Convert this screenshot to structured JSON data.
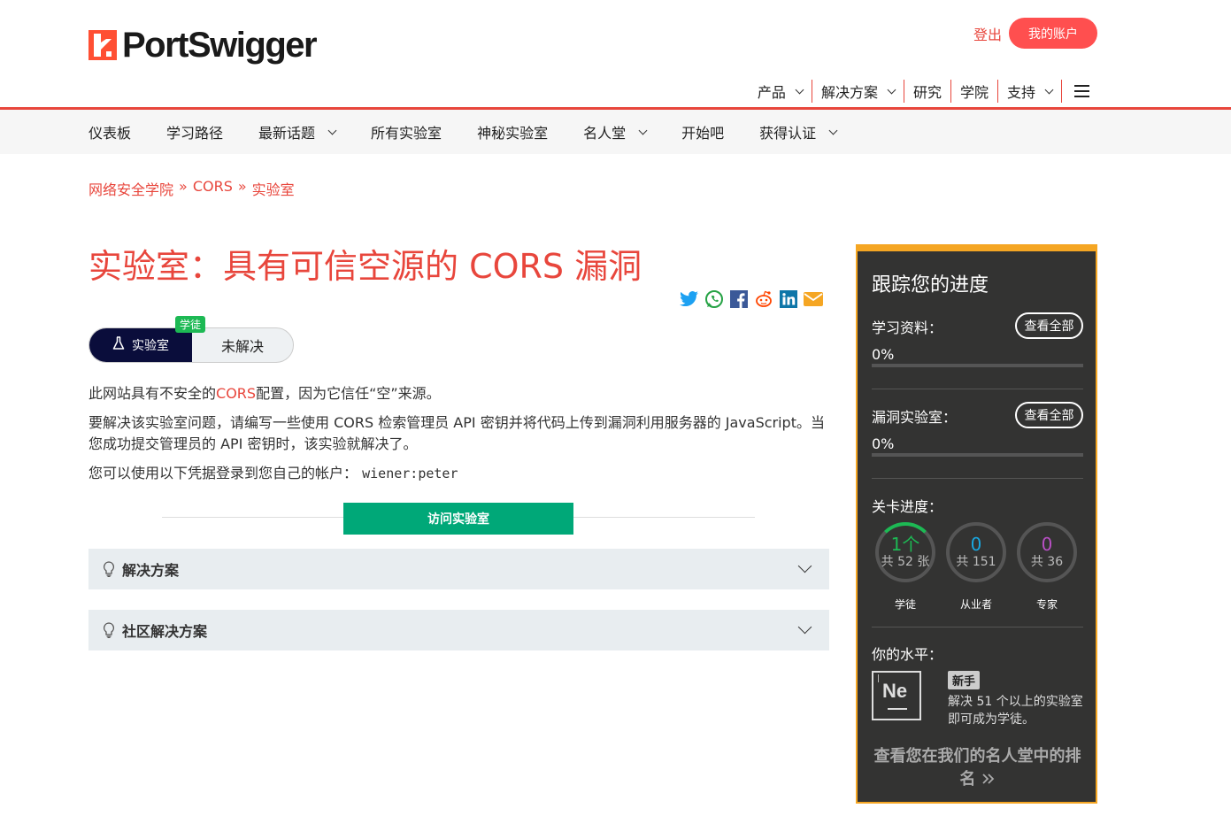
{
  "brand": {
    "name": "PortSwigger",
    "accent": "#e8463c"
  },
  "header": {
    "logout_label": "登出",
    "account_label": "我的账户",
    "topnav": [
      {
        "label": "产品",
        "dropdown": true
      },
      {
        "label": "解决方案",
        "dropdown": true
      },
      {
        "label": "研究",
        "dropdown": false
      },
      {
        "label": "学院",
        "dropdown": false
      },
      {
        "label": "支持",
        "dropdown": true
      }
    ]
  },
  "subnav": {
    "items": [
      {
        "label": "仪表板"
      },
      {
        "label": "学习路径"
      },
      {
        "label": "最新话题"
      },
      {
        "label": "所有实验室"
      },
      {
        "label": "神秘实验室"
      },
      {
        "label": "名人堂"
      },
      {
        "label": "开始吧"
      },
      {
        "label": "获得认证"
      }
    ]
  },
  "breadcrumb": {
    "items": [
      "网络安全学院",
      "CORS",
      "实验室"
    ],
    "separator": "»"
  },
  "page": {
    "title": "实验室：具有可信空源的 CORS 漏洞",
    "share_icons": [
      "twitter-icon",
      "whatsapp-icon",
      "facebook-icon",
      "reddit-icon",
      "linkedin-icon",
      "email-icon"
    ],
    "status": {
      "lab_label": "实验室",
      "level": "学徒",
      "state": "未解决"
    },
    "para1": {
      "before": "此网站具有不安全的",
      "link": "CORS",
      "after": "配置，因为它信任“空”来源。"
    },
    "para2": "要解决该实验室问题，请编写一些使用 CORS 检索管理员 API 密钥并将代码上传到漏洞利用服务器的 JavaScript。当您成功提交管理员的 API 密钥时，该实验就解决了。",
    "para3": {
      "text": "您可以使用以下凭据登录到您自己的帐户：",
      "credentials": "wiener:peter"
    },
    "access_button": "访问实验室",
    "accordions": [
      {
        "label": "解决方案"
      },
      {
        "label": "社区解决方案"
      }
    ]
  },
  "sidebar": {
    "title": "跟踪您的进度",
    "learning": {
      "label": "学习资料：",
      "button": "查看全部",
      "percent": "0%"
    },
    "labs": {
      "label": "漏洞实验室：",
      "button": "查看全部",
      "percent": "0%"
    },
    "levels_label": "关卡进度：",
    "rings": [
      {
        "value": "1个",
        "total": "共 52 张",
        "name": "学徒",
        "color": "#1db954"
      },
      {
        "value": "0",
        "total": "共 151",
        "name": "从业者",
        "color": "#19a7e0"
      },
      {
        "value": "0",
        "total": "共 36",
        "name": "专家",
        "color": "#b84fc4"
      }
    ],
    "your_level_label": "你的水平：",
    "element_symbol": "Ne",
    "level_name": "新手",
    "level_desc": "解决 51 个以上的实验室即可成为学徒。",
    "hall_of_fame": "查看您在我们的名人堂中的排名"
  }
}
